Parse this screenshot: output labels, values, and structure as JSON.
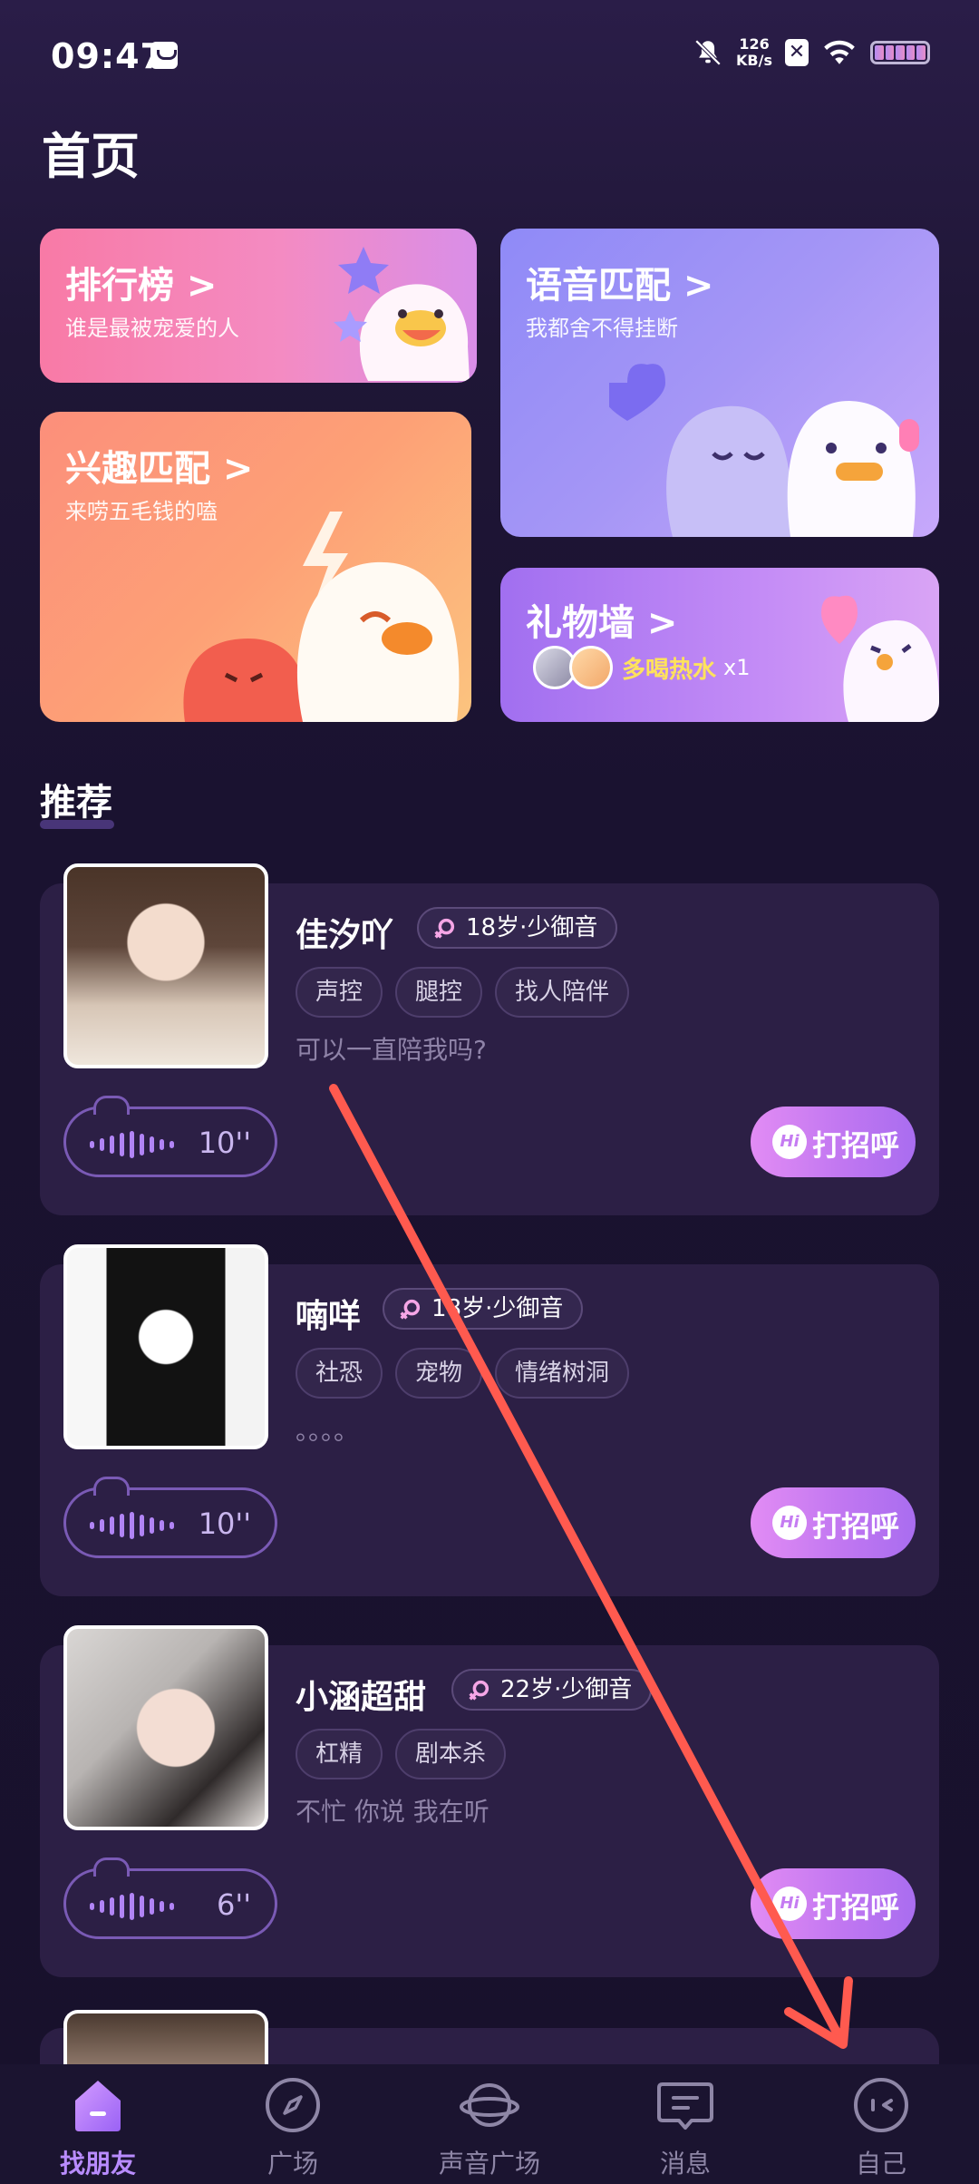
{
  "status": {
    "time": "09:47",
    "speed_value": "126",
    "speed_unit": "KB/s",
    "x_label": "✕"
  },
  "page": {
    "title": "首页"
  },
  "features": {
    "rank": {
      "title": "排行榜 >",
      "subtitle": "谁是最被宠爱的人"
    },
    "voice_match": {
      "title": "语音匹配 >",
      "subtitle": "我都舍不得挂断"
    },
    "interest_match": {
      "title": "兴趣匹配 >",
      "subtitle": "来唠五毛钱的嗑"
    },
    "gift_wall": {
      "title": "礼物墙 >",
      "gift_name": "多喝热水",
      "gift_count": "x1"
    }
  },
  "recommend": {
    "title": "推荐",
    "greet_label": "打招呼",
    "hi_badge": "Hi",
    "users": [
      {
        "name": "佳汐吖",
        "age": "18岁·少御音",
        "tags": [
          "声控",
          "腿控",
          "找人陪伴"
        ],
        "bio": "可以一直陪我吗?",
        "duration": "10''"
      },
      {
        "name": "喃咩",
        "age": "18岁·少御音",
        "tags": [
          "社恐",
          "宠物",
          "情绪树洞"
        ],
        "bio": "。。。。",
        "duration": "10''"
      },
      {
        "name": "小涵超甜",
        "age": "22岁·少御音",
        "tags": [
          "杠精",
          "剧本杀"
        ],
        "bio": "不忙 你说 我在听",
        "duration": "6''"
      }
    ]
  },
  "nav": {
    "items": [
      {
        "label": "找朋友",
        "icon": "home-icon",
        "active": true
      },
      {
        "label": "广场",
        "icon": "compass-icon"
      },
      {
        "label": "声音广场",
        "icon": "planet-icon"
      },
      {
        "label": "消息",
        "icon": "message-icon"
      },
      {
        "label": "自己",
        "icon": "profile-icon"
      }
    ]
  },
  "colors": {
    "background": "#1f1636",
    "accent": "#b98cff",
    "greet_button": "#c177f1",
    "annotation_arrow": "#ff5a4f"
  }
}
